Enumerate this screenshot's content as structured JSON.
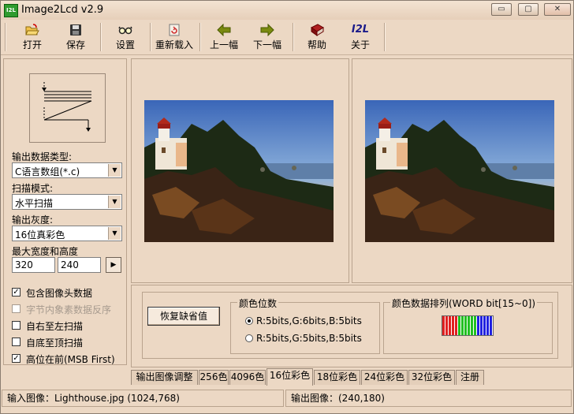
{
  "window": {
    "app_icon_text": "I2L",
    "title": "Image2Lcd v2.9",
    "minimize_glyph": "▭",
    "maximize_glyph": "▢",
    "close_glyph": "✕"
  },
  "toolbar": {
    "open": {
      "label": "打开",
      "icon": "folder-open-icon"
    },
    "save": {
      "label": "保存",
      "icon": "floppy-disk-icon"
    },
    "settings": {
      "label": "设置",
      "icon": "glasses-icon"
    },
    "reload": {
      "label": "重新载入",
      "icon": "reload-icon"
    },
    "prev": {
      "label": "上一幅",
      "icon": "arrow-left-icon"
    },
    "next": {
      "label": "下一幅",
      "icon": "arrow-right-icon"
    },
    "help": {
      "label": "帮助",
      "icon": "help-book-icon"
    },
    "about": {
      "label": "关于",
      "icon": "about-logo-icon",
      "icon_text": "I2L"
    }
  },
  "left_panel": {
    "output_type_label": "输出数据类型:",
    "output_type_value": "C语言数组(*.c)",
    "scan_mode_label": "扫描模式:",
    "scan_mode_value": "水平扫描",
    "gray_label": "输出灰度:",
    "gray_value": "16位真彩色",
    "max_size_label": "最大宽度和高度",
    "max_width": "320",
    "max_height": "240",
    "apply_glyph": "▶",
    "checkboxes": [
      {
        "label": "包含图像头数据",
        "checked": true,
        "enabled": true
      },
      {
        "label": "字节内象素数据反序",
        "checked": false,
        "enabled": false
      },
      {
        "label": "自右至左扫描",
        "checked": false,
        "enabled": true
      },
      {
        "label": "自底至顶扫描",
        "checked": false,
        "enabled": true
      },
      {
        "label": "高位在前(MSB First)",
        "checked": true,
        "enabled": true
      }
    ]
  },
  "settings": {
    "restore_default": "恢复缺省值",
    "color_bits_legend": "颜色位数",
    "color_bits_options": [
      {
        "label": "R:5bits,G:6bits,B:5bits",
        "selected": true
      },
      {
        "label": "R:5bits,G:5bits,B:5bits",
        "selected": false
      }
    ],
    "color_order_legend": "颜色数据排列(WORD bit[15~0])",
    "color_order_colors": {
      "red": "#e02020",
      "green": "#20c020",
      "blue": "#2020e0"
    }
  },
  "tabs": [
    "输出图像调整",
    "256色",
    "4096色",
    "16位彩色",
    "18位彩色",
    "24位彩色",
    "32位彩色",
    "注册"
  ],
  "active_tab": 3,
  "status": {
    "input": "输入图像：Lighthouse.jpg (1024,768)",
    "output": "输出图像：(240,180)"
  }
}
